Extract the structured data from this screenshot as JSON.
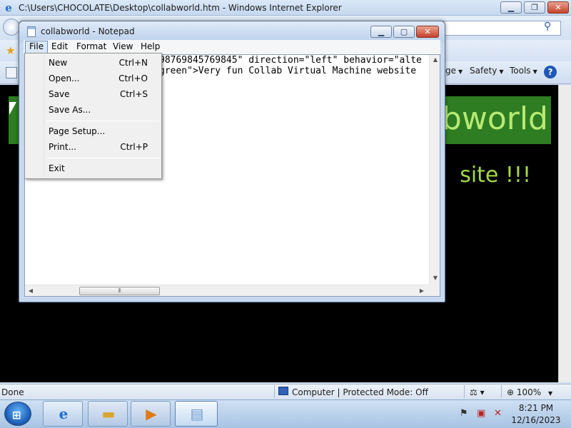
{
  "ie": {
    "title": "C:\\Users\\CHOCOLATE\\Desktop\\collabworld.htm - Windows Internet Explorer",
    "command_bar": {
      "page_label": "ge",
      "safety_label": "Safety",
      "tools_label": "Tools"
    },
    "page": {
      "banner_text": "bworld",
      "subtext": "site !!!"
    },
    "status": {
      "left": "Done",
      "zone": "Computer | Protected Mode: Off",
      "zoom": "100%"
    }
  },
  "notepad": {
    "title": "collabworld - Notepad",
    "menu": [
      "File",
      "Edit",
      "Format",
      "View",
      "Help"
    ],
    "content_lines": [
      "98769845769845\" direction=\"left\" behavior=\"alte",
      "green\">Very fun Collab Virtual Machine website"
    ]
  },
  "file_menu": {
    "items": [
      {
        "label": "New",
        "shortcut": "Ctrl+N"
      },
      {
        "label": "Open...",
        "shortcut": "Ctrl+O"
      },
      {
        "label": "Save",
        "shortcut": "Ctrl+S"
      },
      {
        "label": "Save As...",
        "shortcut": ""
      },
      {
        "label": "Page Setup...",
        "shortcut": ""
      },
      {
        "label": "Print...",
        "shortcut": "Ctrl+P"
      },
      {
        "label": "Exit",
        "shortcut": ""
      }
    ]
  },
  "tray": {
    "time": "8:21 PM",
    "date": "12/16/2023"
  },
  "colors": {
    "banner_bg": "#2e7d22",
    "banner_text": "#b7ea74",
    "subtext": "#a3d844",
    "page_bg": "#000000"
  }
}
